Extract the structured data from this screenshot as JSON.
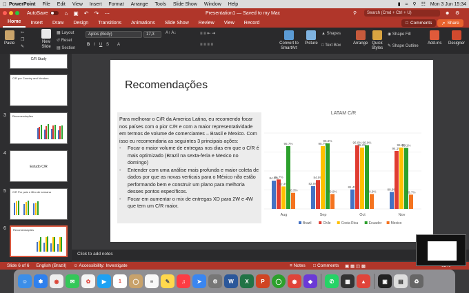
{
  "menubar": {
    "app": "PowerPoint",
    "items": [
      "File",
      "Edit",
      "View",
      "Insert",
      "Format",
      "Arrange",
      "Tools",
      "Slide Show",
      "Window",
      "Help"
    ],
    "clock": "Mon 3 Jun  15:34"
  },
  "titlebar": {
    "autosave": "AutoSave",
    "title": "Presentation1 — Saved to my Mac",
    "search_placeholder": "Search (Cmd + Ctrl + U)"
  },
  "tabs": [
    "Home",
    "Insert",
    "Draw",
    "Design",
    "Transitions",
    "Animations",
    "Slide Show",
    "Review",
    "View",
    "Record"
  ],
  "tab_buttons": {
    "comments": "Comments",
    "share": "Share"
  },
  "ribbon": {
    "paste": "Paste",
    "new_slide": "New Slide",
    "layout": "Layout",
    "reset": "Reset",
    "section": "Section",
    "font": "Aptos (Body)",
    "size": "17,3",
    "convert": "Convert to SmartArt",
    "picture": "Picture",
    "shapes": "Shapes",
    "textbox": "Text Box",
    "arrange": "Arrange",
    "quick_styles": "Quick Styles",
    "shape_fill": "Shape Fill",
    "shape_outline": "Shape Outline",
    "addins": "Add-ins",
    "designer": "Designer"
  },
  "slides": [
    {
      "num": "2",
      "title": "C/R Study"
    },
    {
      "num": "",
      "title": "C/R por Country and Vendors"
    },
    {
      "num": "3",
      "title": "Recomendações"
    },
    {
      "num": "4",
      "title": "Estudo C/R"
    },
    {
      "num": "5",
      "title": "C/R Por país e filtro de semana"
    },
    {
      "num": "6",
      "title": "Recomendações"
    }
  ],
  "slide": {
    "title": "Recomendações",
    "para": "Para melhorar o C/R da America Latina, eu recomendo focar nos países com o pior C/R e com a maior representatividade em termos de volume de comerciantes – Brasil e Mexico. Com isso eu recomendaria as seguintes 3 principais ações:",
    "bullets": [
      "Focar o maior volume de entregas nos dias em que o C/R é mais optimizado (Brazil na sexta-feria e Mexico no domingo)",
      "Entender com uma análise mais profunda e maior coleta de dados por que as novas verticais para o México não estão performando bem e construir um plano para melhoria desses pontos específicos.",
      "Focar em aumentar o mix de entregas XD para 2W e 4W que tem um C/R maior."
    ],
    "bullet_marker": "-"
  },
  "chart_data": {
    "type": "bar",
    "title": "LATAM C/R",
    "categories": [
      "Aug",
      "Sep",
      "Oct",
      "Nov"
    ],
    "series": [
      {
        "name": "Brazil",
        "color": "#4472c4",
        "values": [
          84.3,
          82.5,
          81.4,
          80.6
        ]
      },
      {
        "name": "Chile",
        "color": "#e03c31",
        "values": [
          84.7,
          84.5,
          96.0,
          94.1
        ]
      },
      {
        "name": "Costa Rica",
        "color": "#ffc000",
        "values": [
          82.4,
          95.7,
          95.2,
          95.2
        ]
      },
      {
        "name": "Ecuador",
        "color": "#2ca02c",
        "values": [
          95.7,
          96.6,
          96.0,
          95.1
        ]
      },
      {
        "name": "Mexico",
        "color": "#f4731f",
        "values": [
          80.3,
          79.9,
          79.9,
          79.7
        ]
      }
    ],
    "ylim": [
      75,
      100
    ]
  },
  "notes": "Click to add notes",
  "statusbar": {
    "slide": "Slide 6 of 6",
    "lang": "English (Brazil)",
    "access": "Accessibility: Investigate",
    "notes": "Notes",
    "comments": "Comments",
    "zoom": "68%"
  }
}
